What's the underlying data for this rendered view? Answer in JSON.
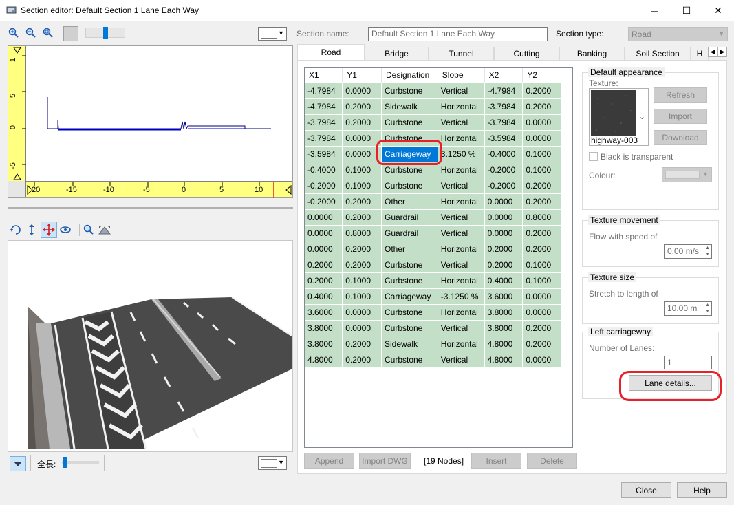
{
  "window": {
    "title": "Section editor: Default Section 1 Lane Each Way",
    "minimize": "─",
    "maximize": "☐",
    "close": "✕"
  },
  "section": {
    "name_label": "Section name:",
    "name_value": "Default Section 1 Lane Each Way",
    "type_label": "Section type:",
    "type_value": "Road"
  },
  "tabs": [
    "Road",
    "Bridge",
    "Tunnel",
    "Cutting",
    "Banking",
    "Soil Section",
    "H"
  ],
  "active_tab": "Road",
  "grid": {
    "columns": [
      "X1",
      "Y1",
      "Designation",
      "Slope",
      "X2",
      "Y2"
    ],
    "rows": [
      [
        "-4.7984",
        "0.0000",
        "Curbstone",
        "Vertical",
        "-4.7984",
        "0.2000"
      ],
      [
        "-4.7984",
        "0.2000",
        "Sidewalk",
        "Horizontal",
        "-3.7984",
        "0.2000"
      ],
      [
        "-3.7984",
        "0.2000",
        "Curbstone",
        "Vertical",
        "-3.7984",
        "0.0000"
      ],
      [
        "-3.7984",
        "0.0000",
        "Curbstone",
        "Horizontal",
        "-3.5984",
        "0.0000"
      ],
      [
        "-3.5984",
        "0.0000",
        "Carriageway",
        "3.1250 %",
        "-0.4000",
        "0.1000"
      ],
      [
        "-0.4000",
        "0.1000",
        "Curbstone",
        "Horizontal",
        "-0.2000",
        "0.1000"
      ],
      [
        "-0.2000",
        "0.1000",
        "Curbstone",
        "Vertical",
        "-0.2000",
        "0.2000"
      ],
      [
        "-0.2000",
        "0.2000",
        "Other",
        "Horizontal",
        "0.0000",
        "0.2000"
      ],
      [
        "0.0000",
        "0.2000",
        "Guardrail",
        "Vertical",
        "0.0000",
        "0.8000"
      ],
      [
        "0.0000",
        "0.8000",
        "Guardrail",
        "Vertical",
        "0.0000",
        "0.2000"
      ],
      [
        "0.0000",
        "0.2000",
        "Other",
        "Horizontal",
        "0.2000",
        "0.2000"
      ],
      [
        "0.2000",
        "0.2000",
        "Curbstone",
        "Vertical",
        "0.2000",
        "0.1000"
      ],
      [
        "0.2000",
        "0.1000",
        "Curbstone",
        "Horizontal",
        "0.4000",
        "0.1000"
      ],
      [
        "0.4000",
        "0.1000",
        "Carriageway",
        "-3.1250 %",
        "3.6000",
        "0.0000"
      ],
      [
        "3.6000",
        "0.0000",
        "Curbstone",
        "Horizontal",
        "3.8000",
        "0.0000"
      ],
      [
        "3.8000",
        "0.0000",
        "Curbstone",
        "Vertical",
        "3.8000",
        "0.2000"
      ],
      [
        "3.8000",
        "0.2000",
        "Sidewalk",
        "Horizontal",
        "4.8000",
        "0.2000"
      ],
      [
        "4.8000",
        "0.2000",
        "Curbstone",
        "Vertical",
        "4.8000",
        "0.0000"
      ]
    ],
    "selected_row": 4,
    "selected_col": 2
  },
  "grid_buttons": {
    "append": "Append",
    "import_dwg": "Import DWG",
    "nodes": "[19 Nodes]",
    "insert": "Insert",
    "delete": "Delete"
  },
  "appearance": {
    "title": "Default appearance",
    "texture_label": "Texture:",
    "texture_name": "highway-003",
    "refresh": "Refresh",
    "import": "Import",
    "download": "Download",
    "black_transparent": "Black is transparent",
    "colour_label": "Colour:"
  },
  "movement": {
    "title": "Texture movement",
    "label": "Flow with speed of",
    "value": "0.00 m/s"
  },
  "size": {
    "title": "Texture size",
    "label": "Stretch to length of",
    "value": "10.00 m"
  },
  "left_carriageway": {
    "title": "Left carriageway",
    "label": "Number of Lanes:",
    "value": "1",
    "lane_details": "Lane details..."
  },
  "footer": {
    "close": "Close",
    "help": "Help"
  },
  "preview2d": {
    "ruler_v": [
      "1",
      "5",
      "0",
      "-5"
    ],
    "ruler_h": [
      "20",
      "-15",
      "-10",
      "-5",
      "0",
      "5",
      "10"
    ]
  },
  "preview3d": {
    "length_label": "全長:"
  },
  "colors": {
    "grid_row": "#c4dfc8",
    "selection": "#0078d7",
    "ruler": "#ffff80",
    "profile": "#0000c0",
    "highlight": "#e8202a"
  }
}
